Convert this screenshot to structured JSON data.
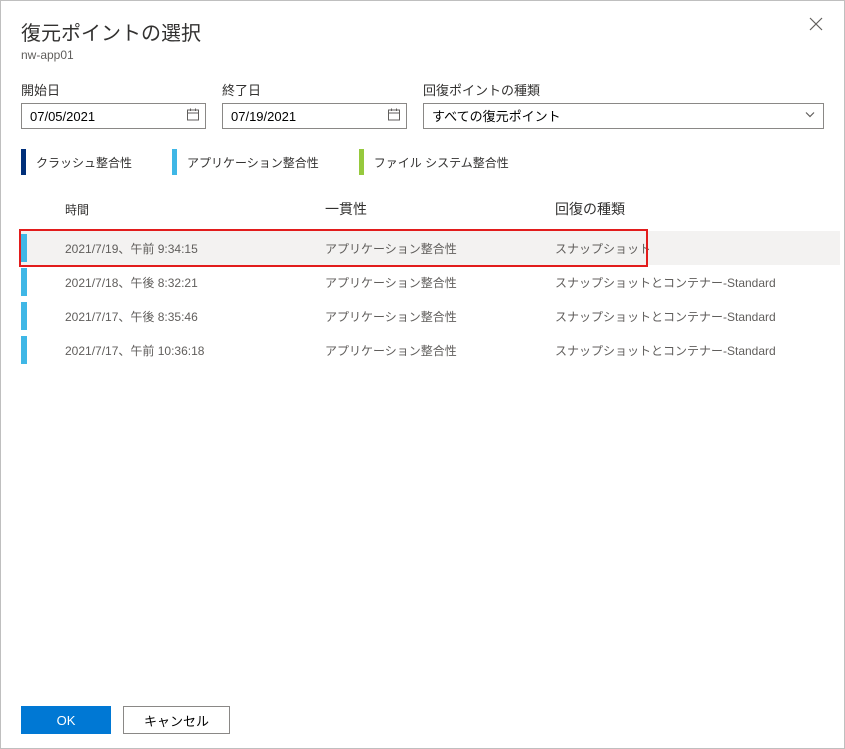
{
  "header": {
    "title": "復元ポイントの選択",
    "subtitle": "nw-app01"
  },
  "filters": {
    "startLabel": "開始日",
    "startValue": "07/05/2021",
    "endLabel": "終了日",
    "endValue": "07/19/2021",
    "typeLabel": "回復ポイントの種類",
    "typeValue": "すべての復元ポイント"
  },
  "legend": {
    "crash": "クラッシュ整合性",
    "app": "アプリケーション整合性",
    "fs": "ファイル システム整合性"
  },
  "columns": {
    "time": "時間",
    "consistency": "一貫性",
    "recoveryType": "回復の種類"
  },
  "rows": [
    {
      "time": "2021/7/19、午前 9:34:15",
      "consistency": "アプリケーション整合性",
      "recoveryType": "スナップショット",
      "color": "app",
      "selected": true
    },
    {
      "time": "2021/7/18、午後 8:32:21",
      "consistency": "アプリケーション整合性",
      "recoveryType": "スナップショットとコンテナー-Standard",
      "color": "app",
      "selected": false
    },
    {
      "time": "2021/7/17、午後 8:35:46",
      "consistency": "アプリケーション整合性",
      "recoveryType": "スナップショットとコンテナー-Standard",
      "color": "app",
      "selected": false
    },
    {
      "time": "2021/7/17、午前 10:36:18",
      "consistency": "アプリケーション整合性",
      "recoveryType": "スナップショットとコンテナー-Standard",
      "color": "app",
      "selected": false
    }
  ],
  "footer": {
    "ok": "OK",
    "cancel": "キャンセル"
  },
  "colors": {
    "crash": "#002f7a",
    "app": "#3fb7e6",
    "fs": "#96c93d"
  }
}
